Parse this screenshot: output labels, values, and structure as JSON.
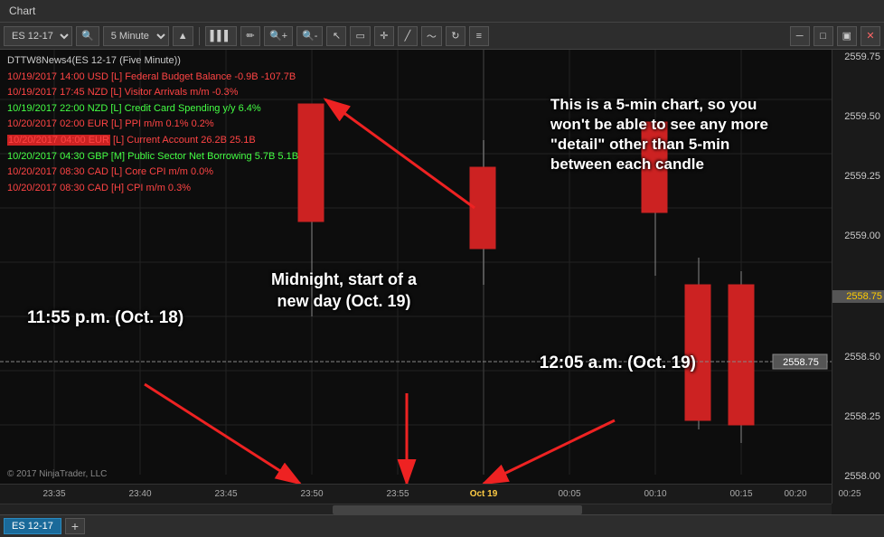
{
  "menubar": {
    "items": [
      "Chart"
    ]
  },
  "toolbar": {
    "symbol": "ES 12-17",
    "timeframe": "5 Minute",
    "buttons": [
      "search",
      "bar",
      "bar2",
      "pencil",
      "zoom-in",
      "zoom-out",
      "cursor",
      "rect",
      "crosshair",
      "line",
      "wave",
      "refresh",
      "list"
    ]
  },
  "chart": {
    "title": "DTTW8News4(ES 12-17 (Five Minute))",
    "news_items": [
      {
        "time": "10/19/2017 14:00",
        "currency": "USD",
        "impact": "L",
        "text": "Federal Budget Balance -0.9B -107.7B",
        "color": "red"
      },
      {
        "time": "10/19/2017 17:45",
        "currency": "NZD",
        "impact": "L",
        "text": "Visitor Arrivals m/m  -0.3%",
        "color": "red"
      },
      {
        "time": "10/19/2017 22:00",
        "currency": "NZD",
        "impact": "L",
        "text": "Credit Card Spending y/y  6.4%",
        "color": "green"
      },
      {
        "time": "10/20/2017 02:00",
        "currency": "EUR",
        "impact": "L",
        "text": "PPI m/m  0.1%  0.2%",
        "color": "red"
      },
      {
        "time": "10/20/2017 04:00",
        "currency": "EUR",
        "impact": "L",
        "text": "Current Account  26.2B  25.1B",
        "color": "red"
      },
      {
        "time": "10/20/2017 04:30",
        "currency": "GBP",
        "impact": "M",
        "text": "Public Sector Net Borrowing 5.7B 5.1B",
        "color": "green"
      },
      {
        "time": "10/20/2017 08:30",
        "currency": "CAD",
        "impact": "L",
        "text": "Core CPI m/m  0.0%",
        "color": "red"
      },
      {
        "time": "10/20/2017 08:30",
        "currency": "CAD",
        "impact": "H",
        "text": "CPI m/m  0.3%",
        "color": "red"
      }
    ],
    "annotations": {
      "a1_text": "This is a 5-min chart, so you\nwon't be able to see any more\n\"detail\" other than 5-min\nbetween each candle",
      "a2_text": "11:55 p.m. (Oct. 18)",
      "a3_text": "Midnight, start of a\nnew day (Oct. 19)",
      "a4_text": "12:05 a.m. (Oct. 19)"
    },
    "price_levels": [
      "2559.75",
      "2559.50",
      "2559.25",
      "2559.00",
      "2558.75",
      "2558.50",
      "2558.25",
      "2558.00"
    ],
    "current_price": "2558.75",
    "time_labels": [
      "23:35",
      "23:40",
      "23:45",
      "23:50",
      "23:55",
      "Oct 19",
      "00:05",
      "00:10",
      "00:15",
      "00:20",
      "00:25"
    ]
  },
  "tabs": [
    {
      "label": "ES 12-17",
      "active": true
    }
  ],
  "tab_add_label": "+",
  "copyright": "© 2017 NinjaTrader, LLC"
}
